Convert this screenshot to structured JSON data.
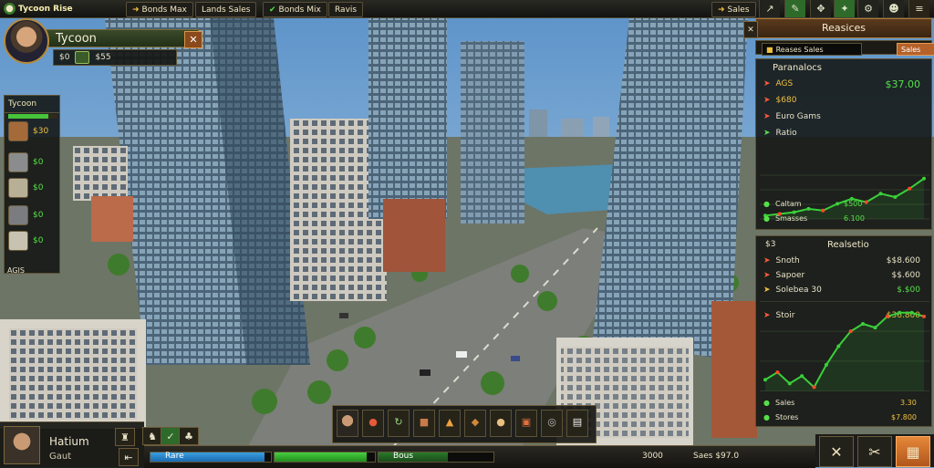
{
  "topbar": {
    "title": "Tycoon Rise",
    "tab1": "Bonds Max",
    "tab2": "Lands Sales",
    "tab3": "Bonds Mix",
    "tab4": "Ravis",
    "money": "Sales"
  },
  "player": {
    "name": "Tycoon",
    "stat_a": "$0",
    "stat_b": "$55"
  },
  "resources": {
    "header": "Tycoon",
    "items": [
      {
        "name": "wood",
        "value": "$30"
      },
      {
        "name": "metal",
        "value": "$0"
      },
      {
        "name": "stone",
        "value": "$0"
      },
      {
        "name": "steel",
        "value": "$0"
      },
      {
        "name": "concrete",
        "value": "$0"
      }
    ],
    "footer": "AGIS",
    "fill": 0.82
  },
  "right_panel": {
    "title": "Reasices",
    "subbar_left": "Reases Sales",
    "subbar_right": "Sales"
  },
  "stats": {
    "title": "Paranalocs",
    "rows": [
      {
        "label": "AGS",
        "value": "$37.00",
        "color": "#e88a3a"
      },
      {
        "label": "$680",
        "value": "",
        "color": "#ff5a3a"
      },
      {
        "label": "Euro Gams",
        "value": "",
        "color": "#e88a3a"
      },
      {
        "label": "Ratio",
        "value": "",
        "color": "#56e04a"
      }
    ],
    "footer": [
      {
        "label": "Caltam",
        "value": "$500"
      },
      {
        "label": "Smasses",
        "value": "6.100"
      }
    ]
  },
  "market": {
    "title_left": "$3",
    "title": "Realsetio",
    "rows": [
      {
        "label": "Snoth",
        "value": "$$8.600"
      },
      {
        "label": "Sapoer",
        "value": "$$.600"
      },
      {
        "label": "Solebea 30",
        "value": "$.$00"
      },
      {
        "label": "Stoir",
        "value": "$36.800"
      }
    ],
    "footer": [
      {
        "label": "Sales",
        "value": "3.30"
      },
      {
        "label": "Stores",
        "value": "$7.800"
      }
    ]
  },
  "bottom": {
    "bar1_label": "Rare",
    "bar1_fill": 0.95,
    "bar2_label": "",
    "bar2_fill": 0.92,
    "bar3_label": "Bous",
    "bar3_fill": 0.6,
    "text_a": "3000",
    "text_b": "Saes $97.0"
  },
  "profile": {
    "name": "Hatium",
    "sub": "Gaut"
  },
  "chart_data": [
    {
      "type": "line",
      "title": "Paranalocs",
      "x": [
        1,
        2,
        3,
        4,
        5,
        6,
        7,
        8,
        9,
        10,
        11,
        12
      ],
      "series": [
        {
          "values": [
            2,
            3,
            4,
            6,
            5,
            9,
            12,
            10,
            15,
            13,
            18,
            24
          ]
        }
      ],
      "ylim": [
        0,
        26
      ],
      "color": "#3ad03a"
    },
    {
      "type": "line",
      "title": "Realsetio",
      "x": [
        1,
        2,
        3,
        4,
        5,
        6,
        7,
        8,
        9,
        10,
        11,
        12,
        13,
        14
      ],
      "series": [
        {
          "values": [
            3,
            5,
            2,
            4,
            1,
            7,
            12,
            16,
            18,
            17,
            20,
            21,
            21,
            20
          ]
        }
      ],
      "ylim": [
        0,
        24
      ],
      "color": "#3ad03a"
    }
  ]
}
